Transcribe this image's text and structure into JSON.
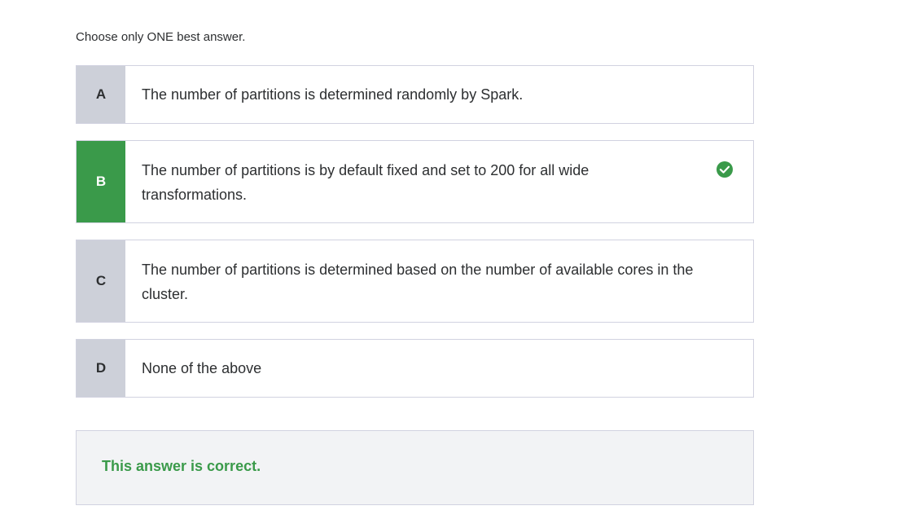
{
  "instruction": "Choose only ONE best answer.",
  "options": [
    {
      "letter": "A",
      "text": "The number of partitions is determined randomly by Spark.",
      "state": "default"
    },
    {
      "letter": "B",
      "text": "The number of partitions is by default fixed and set to 200 for all wide transformations.",
      "state": "correct"
    },
    {
      "letter": "C",
      "text": "The number of partitions is determined based on the number of available cores in the cluster.",
      "state": "default"
    },
    {
      "letter": "D",
      "text": "None of the above",
      "state": "default"
    }
  ],
  "feedback": {
    "message": "This answer is correct."
  },
  "colors": {
    "correct_green": "#3a9a4a",
    "letter_gray": "#cdd0d9",
    "border": "#d1d2e0",
    "feedback_bg": "#f2f3f5"
  },
  "icons": {
    "correct": "check-circle-icon"
  }
}
